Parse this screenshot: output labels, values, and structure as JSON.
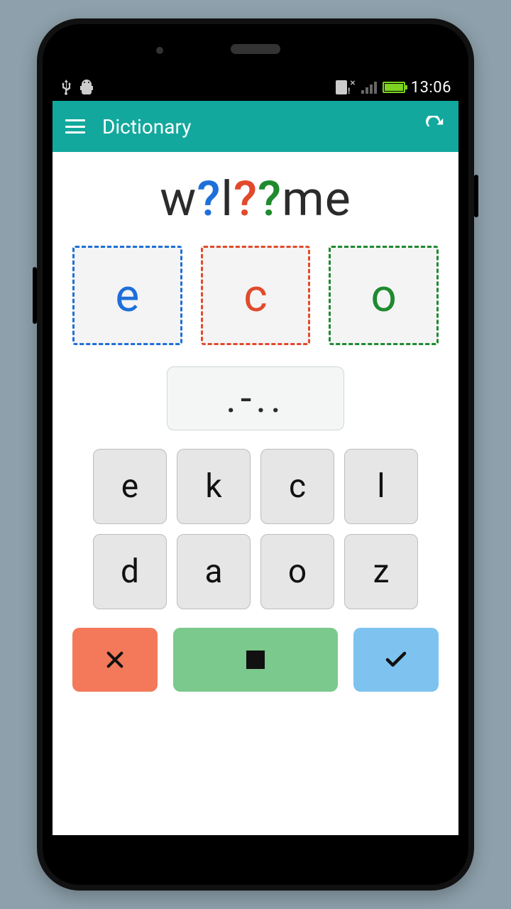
{
  "statusbar": {
    "time": "13:06"
  },
  "appbar": {
    "title": "Dictionary"
  },
  "word": {
    "parts": [
      "w",
      "?",
      "l",
      "?",
      "?",
      "me"
    ]
  },
  "hints": [
    {
      "letter": "e",
      "color": "blue"
    },
    {
      "letter": "c",
      "color": "orange"
    },
    {
      "letter": "o",
      "color": "green"
    }
  ],
  "morse": ".-..",
  "keys": [
    "e",
    "k",
    "c",
    "l",
    "d",
    "a",
    "o",
    "z"
  ]
}
